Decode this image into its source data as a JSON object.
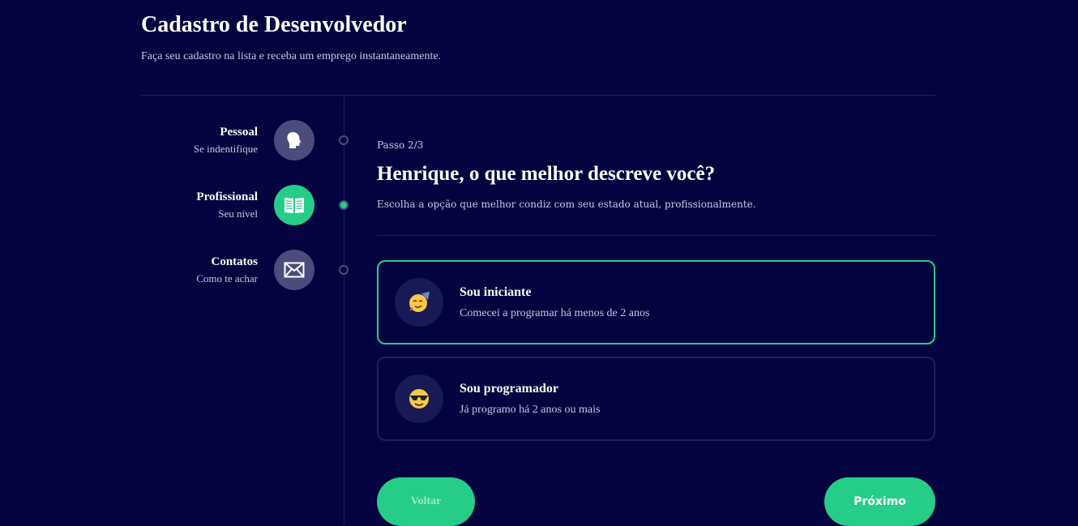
{
  "header": {
    "title": "Cadastro de Desenvolvedor",
    "subtitle": "Faça seu cadastro na lista e receba um emprego instantaneamente."
  },
  "steps": [
    {
      "title": "Pessoal",
      "subtitle": "Se indentifique",
      "icon": "head-icon",
      "active": false
    },
    {
      "title": "Profissional",
      "subtitle": "Seu nível",
      "icon": "book-icon",
      "active": true
    },
    {
      "title": "Contatos",
      "subtitle": "Como te achar",
      "icon": "mail-icon",
      "active": false
    }
  ],
  "main": {
    "step_label": "Passo 2/3",
    "question": "Henrique, o que melhor descreve você?",
    "description": "Escolha a opção que melhor condiz com seu estado atual, profissionalmente."
  },
  "options": [
    {
      "title": "Sou iniciante",
      "description": "Comecei a programar há menos de 2 anos",
      "icon": "party-face-icon",
      "selected": true
    },
    {
      "title": "Sou programador",
      "description": "Já programo há 2 anos ou mais",
      "icon": "sunglasses-face-icon",
      "selected": false
    }
  ],
  "buttons": {
    "back": "Voltar",
    "next": "Próximo"
  },
  "colors": {
    "background": "#02033f",
    "accent": "#25cd89",
    "inactive": "#4b4c7c",
    "border": "#1e2060"
  }
}
